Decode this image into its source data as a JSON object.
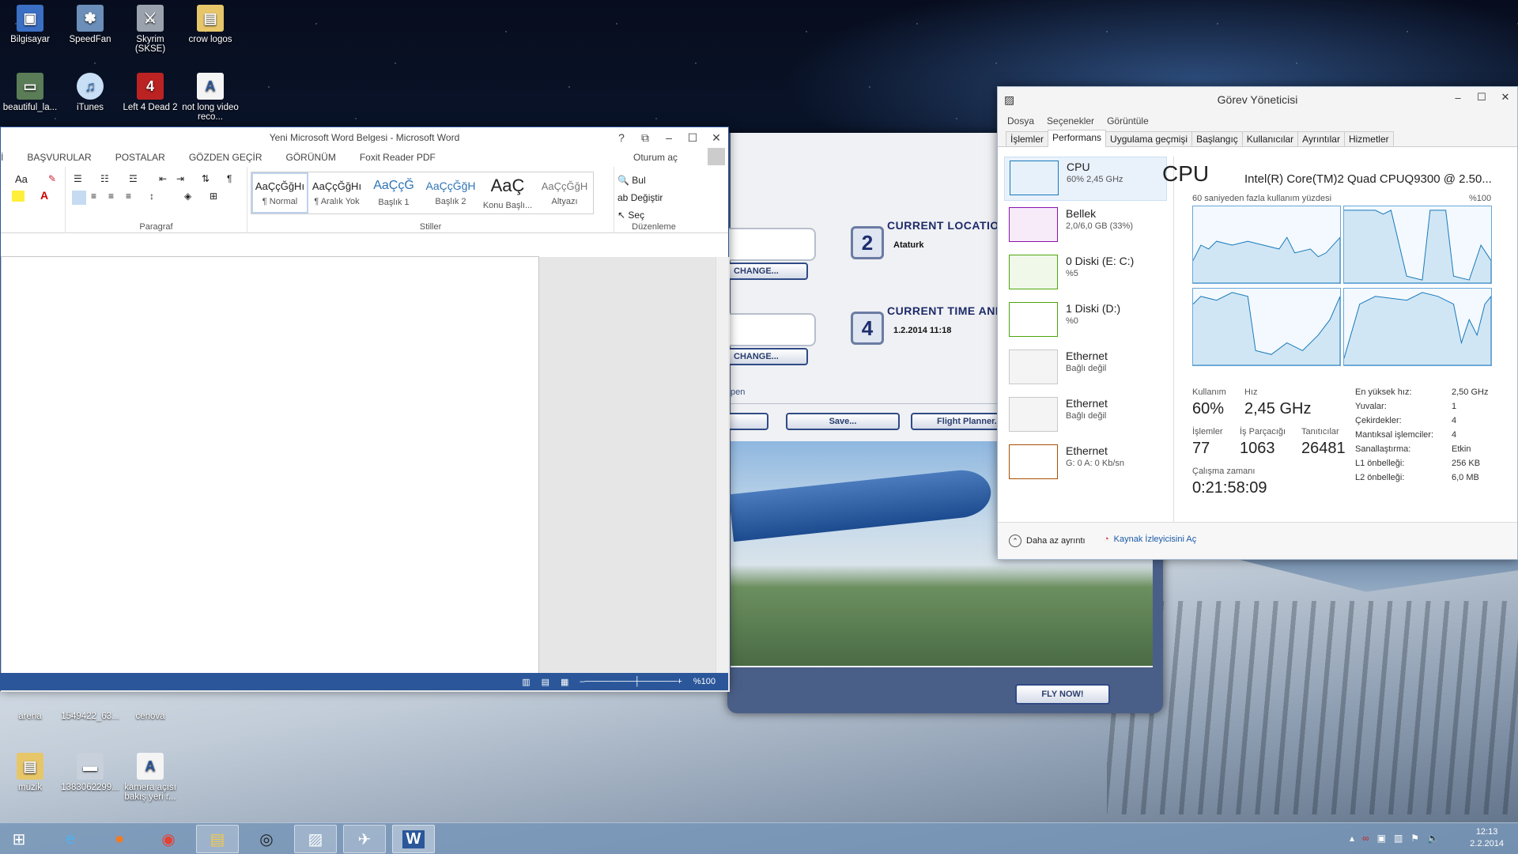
{
  "desktop": {
    "icons": [
      {
        "label": "Bilgisayar"
      },
      {
        "label": "SpeedFan"
      },
      {
        "label": "Skyrim (SKSE)"
      },
      {
        "label": "crow logos"
      },
      {
        "label": "beautiful_la..."
      },
      {
        "label": "iTunes"
      },
      {
        "label": "Left 4 Dead 2"
      },
      {
        "label": "not long video reco..."
      },
      {
        "label": "arena"
      },
      {
        "label": "1549422_63..."
      },
      {
        "label": "cenova"
      },
      {
        "label": "müzik"
      },
      {
        "label": "1383062299..."
      },
      {
        "label": "kamera açısı bakış yeri r..."
      }
    ]
  },
  "word": {
    "title": "Yeni Microsoft Word Belgesi - Microsoft Word",
    "help": "?",
    "tabs": [
      "İ",
      "BAŞVURULAR",
      "POSTALAR",
      "GÖZDEN GEÇİR",
      "GÖRÜNÜM",
      "Foxit Reader PDF"
    ],
    "signin": "Oturum aç",
    "font_size_label": "Aa",
    "groups": {
      "paragraph": "Paragraf",
      "styles": "Stiller",
      "editing": "Düzenleme"
    },
    "styles": [
      {
        "preview": "AaÇçĞğHı",
        "name": "¶ Normal"
      },
      {
        "preview": "AaÇçĞğHı",
        "name": "¶ Aralık Yok"
      },
      {
        "preview": "AaÇçĞ",
        "name": "Başlık 1"
      },
      {
        "preview": "AaÇçĞğH",
        "name": "Başlık 2"
      },
      {
        "preview": "AaÇ",
        "name": "Konu Başlı..."
      },
      {
        "preview": "AaÇçĞğH",
        "name": "Altyazı"
      }
    ],
    "editing": [
      "Bul",
      "Değiştir",
      "Seç"
    ],
    "zoom": "%100"
  },
  "fsx": {
    "location_num": "2",
    "location_head": "CURRENT LOCATION",
    "location_val": "Ataturk",
    "time_num": "4",
    "time_head": "CURRENT TIME AND",
    "time_val": "1.2.2014 11:18",
    "change1": "CHANGE...",
    "change2": "CHANGE...",
    "open_text": "pen",
    "save": "Save...",
    "planner": "Flight Planner...",
    "fly": "FLY NOW!"
  },
  "taskmgr": {
    "title": "Görev Yöneticisi",
    "menu": [
      "Dosya",
      "Seçenekler",
      "Görüntüle"
    ],
    "tabs": [
      "İşlemler",
      "Performans",
      "Uygulama geçmişi",
      "Başlangıç",
      "Kullanıcılar",
      "Ayrıntılar",
      "Hizmetler"
    ],
    "resources": [
      {
        "name": "CPU",
        "sub": "60% 2,45 GHz",
        "color": "#1779ba"
      },
      {
        "name": "Bellek",
        "sub": "2,0/6,0 GB (33%)",
        "color": "#8b12ae"
      },
      {
        "name": "0 Diski (E: C:)",
        "sub": "%5",
        "color": "#4da60c"
      },
      {
        "name": "1 Diski (D:)",
        "sub": "%0",
        "color": "#4da60c"
      },
      {
        "name": "Ethernet",
        "sub": "Bağlı değil",
        "color": "#c8c8c8"
      },
      {
        "name": "Ethernet",
        "sub": "Bağlı değil",
        "color": "#c8c8c8"
      },
      {
        "name": "Ethernet",
        "sub": "G: 0 A: 0 Kb/sn",
        "color": "#a74f01"
      }
    ],
    "cpu_title": "CPU",
    "cpu_model": "Intel(R) Core(TM)2 Quad CPUQ9300 @ 2.50...",
    "graph_caption": "60 saniyeden fazla kullanım yüzdesi",
    "graph_max": "%100",
    "stats": {
      "usage_label": "Kullanım",
      "usage": "60%",
      "speed_label": "Hız",
      "speed": "2,45 GHz",
      "proc_label": "İşlemler",
      "proc": "77",
      "threads_label": "İş Parçacığı",
      "threads": "1063",
      "handles_label": "Tanıtıcılar",
      "handles": "26481",
      "uptime_label": "Çalışma zamanı",
      "uptime": "0:21:58:09"
    },
    "specs": [
      {
        "k": "En yüksek hız:",
        "v": "2,50 GHz"
      },
      {
        "k": "Yuvalar:",
        "v": "1"
      },
      {
        "k": "Çekirdekler:",
        "v": "4"
      },
      {
        "k": "Mantıksal işlemciler:",
        "v": "4"
      },
      {
        "k": "Sanallaştırma:",
        "v": "Etkin"
      },
      {
        "k": "L1 önbelleği:",
        "v": "256 KB"
      },
      {
        "k": "L2 önbelleği:",
        "v": "6,0 MB"
      }
    ],
    "less_details": "Daha az ayrıntı",
    "resmon": "Kaynak İzleyicisini Aç"
  },
  "taskbar": {
    "time": "12:13",
    "date": "2.2.2014"
  }
}
